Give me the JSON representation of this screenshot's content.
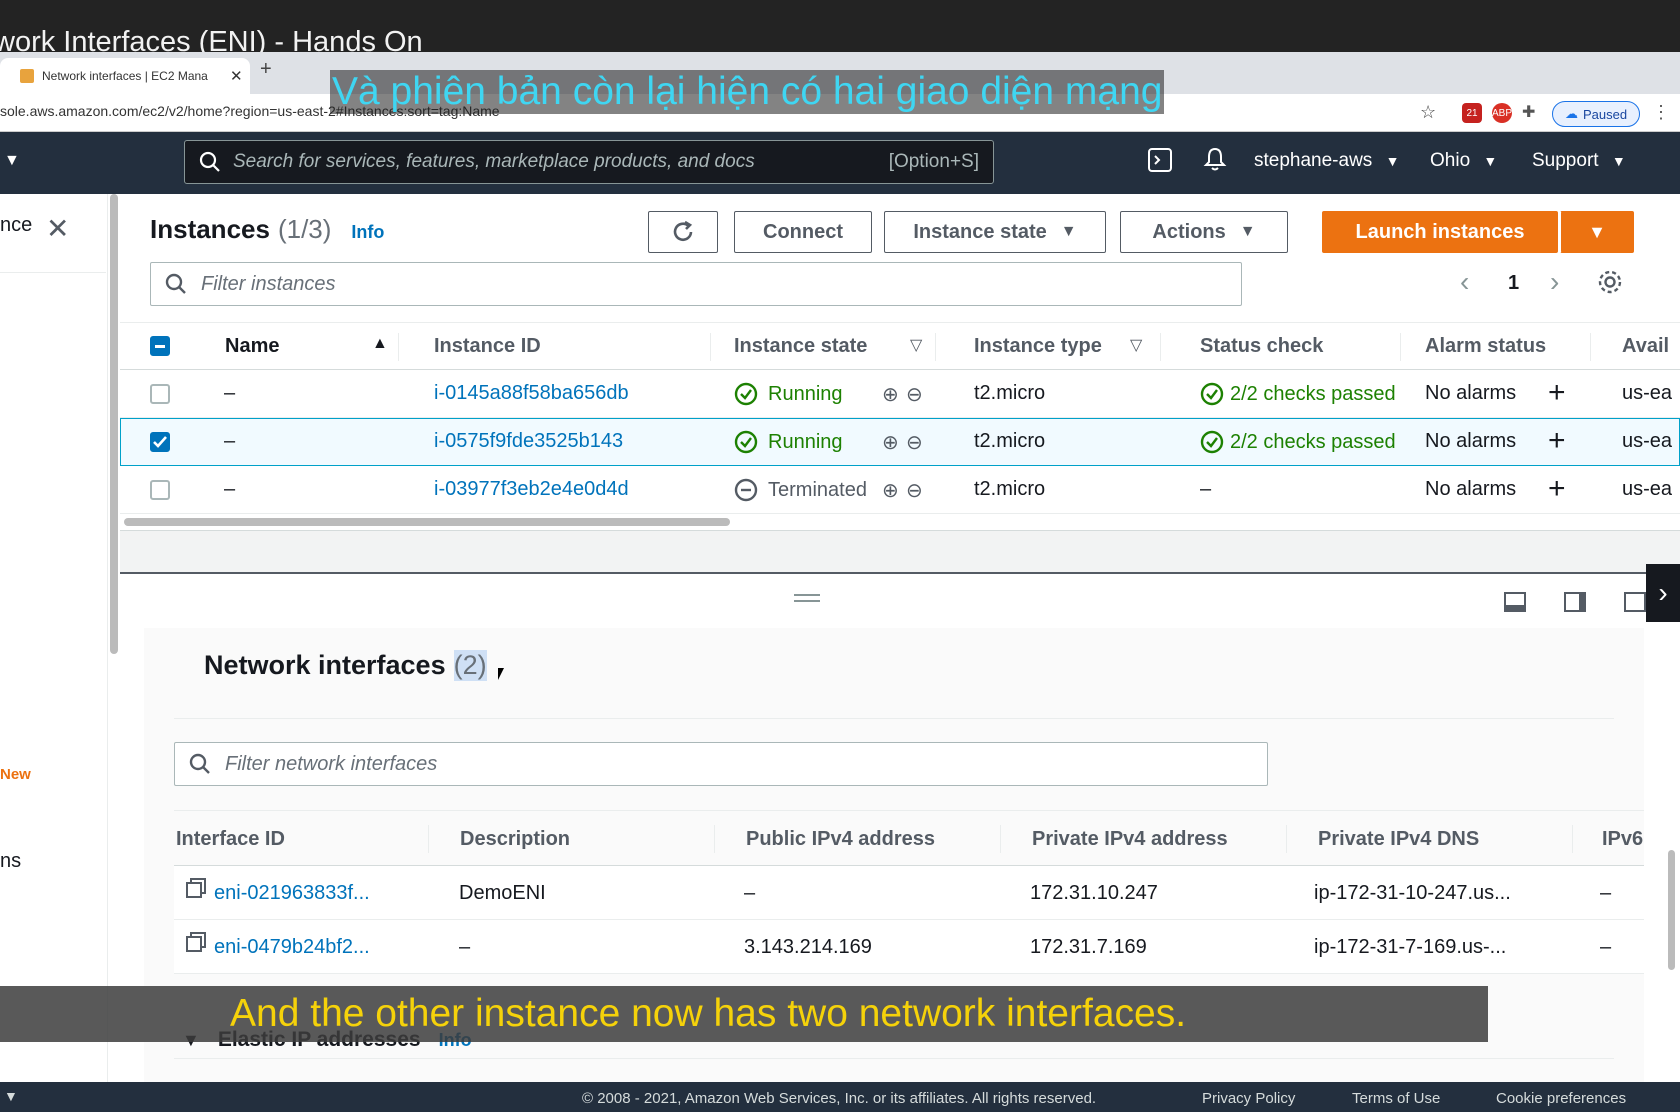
{
  "video": {
    "title": "work Interfaces (ENI) - Hands On"
  },
  "browser": {
    "tab_title": "Network interfaces | EC2 Mana",
    "url": "sole.aws.amazon.com/ec2/v2/home?region=us-east-2#Instances:sort=tag:Name",
    "paused_label": "Paused",
    "ext_badge": "21"
  },
  "topnav": {
    "search_placeholder": "Search for services, features, marketplace products, and docs",
    "search_shortcut": "[Option+S]",
    "account": "stephane-aws",
    "region": "Ohio",
    "support": "Support"
  },
  "leftpanel": {
    "partial_title": "nce",
    "new_badge": "New",
    "partial_item": "ns"
  },
  "instances": {
    "title": "Instances",
    "count": "(1/3)",
    "info": "Info",
    "connect": "Connect",
    "instance_state": "Instance state",
    "actions": "Actions",
    "launch": "Launch instances",
    "filter_placeholder": "Filter instances",
    "page": "1",
    "columns": [
      "Name",
      "Instance ID",
      "Instance state",
      "Instance type",
      "Status check",
      "Alarm status",
      "Avail"
    ],
    "rows": [
      {
        "name": "–",
        "id": "i-0145a88f58ba656db",
        "state": "Running",
        "type": "t2.micro",
        "status": "2/2 checks passed",
        "alarm": "No alarms",
        "az": "us-ea",
        "selected": false
      },
      {
        "name": "–",
        "id": "i-0575f9fde3525b143",
        "state": "Running",
        "type": "t2.micro",
        "status": "2/2 checks passed",
        "alarm": "No alarms",
        "az": "us-ea",
        "selected": true
      },
      {
        "name": "–",
        "id": "i-03977f3eb2e4e0d4d",
        "state": "Terminated",
        "type": "t2.micro",
        "status": "–",
        "alarm": "No alarms",
        "az": "us-ea",
        "selected": false
      }
    ]
  },
  "network_interfaces": {
    "title": "Network interfaces",
    "count": "(2)",
    "filter_placeholder": "Filter network interfaces",
    "columns": [
      "Interface ID",
      "Description",
      "Public IPv4 address",
      "Private IPv4 address",
      "Private IPv4 DNS",
      "IPv6"
    ],
    "rows": [
      {
        "id": "eni-021963833f...",
        "description": "DemoENI",
        "public_ip": "–",
        "private_ip": "172.31.10.247",
        "private_dns": "ip-172-31-10-247.us...",
        "ipv6": "–"
      },
      {
        "id": "eni-0479b24bf2...",
        "description": "–",
        "public_ip": "3.143.214.169",
        "private_ip": "172.31.7.169",
        "private_dns": "ip-172-31-7-169.us-...",
        "ipv6": "–"
      }
    ]
  },
  "elastic_ip": {
    "title": "Elastic IP addresses",
    "info": "Info"
  },
  "subtitles": {
    "vi": "Và phiên bản còn lại hiện có hai giao diện mạng",
    "en": "And the other instance now has two network interfaces."
  },
  "footer": {
    "copyright": "© 2008 - 2021, Amazon Web Services, Inc. or its affiliates. All rights reserved.",
    "privacy": "Privacy Policy",
    "terms": "Terms of Use",
    "cookie": "Cookie preferences"
  },
  "colors": {
    "accent": "#ec7211",
    "link": "#0073bb",
    "success": "#1d8102",
    "nav": "#232f3e"
  }
}
